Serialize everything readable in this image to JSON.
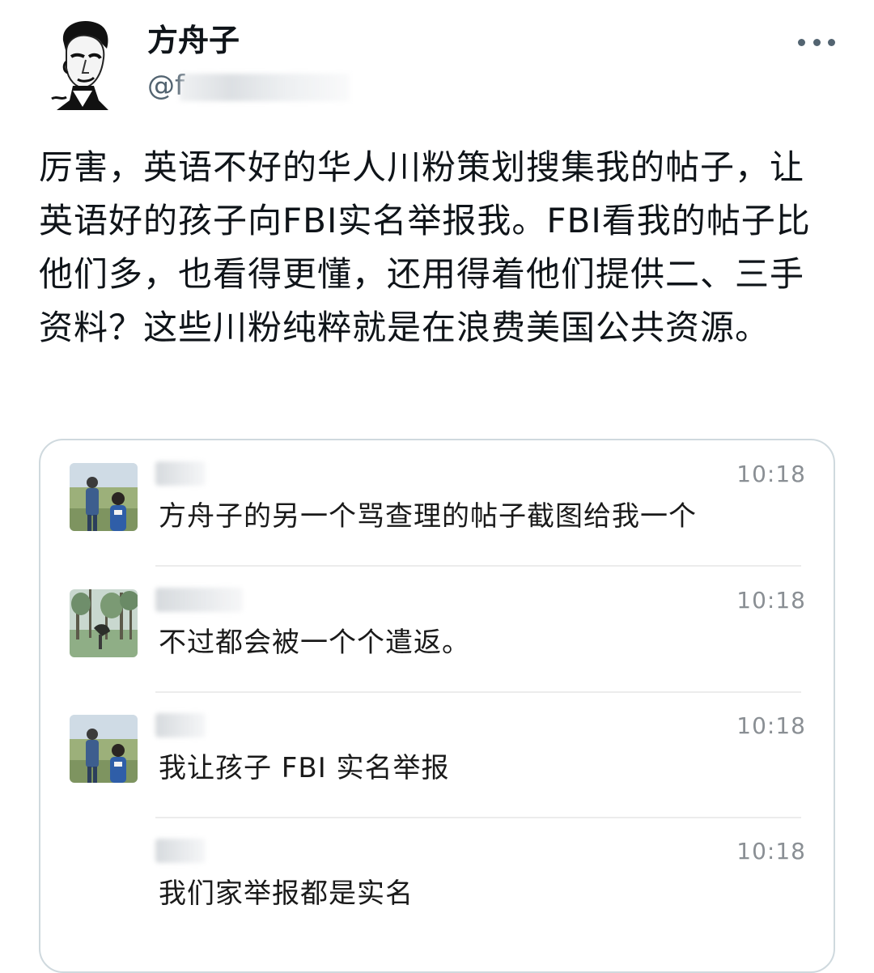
{
  "post": {
    "author_name": "方舟子",
    "handle_visible": "@f",
    "text": "厉害，英语不好的华人川粉策划搜集我的帖子，让英语好的孩子向FBI实名举报我。FBI看我的帖子比他们多，也看得更懂，还用得着他们提供二、三手资料？这些川粉纯粹就是在浪费美国公共资源。",
    "more_icon": "more-horizontal-icon"
  },
  "embedded_chat": {
    "messages": [
      {
        "time": "10:18",
        "text": "方舟子的另一个骂查理的帖子截图给我一个",
        "avatar": "photo-two-people"
      },
      {
        "time": "10:18",
        "text": "不过都会被一个个遣返。",
        "avatar": "photo-park-trees"
      },
      {
        "time": "10:18",
        "text": "我让孩子 FBI 实名举报",
        "avatar": "photo-two-people"
      },
      {
        "time": "10:18",
        "text": "我们家举报都是实名",
        "avatar": ""
      }
    ]
  },
  "colors": {
    "text_primary": "#0f1419",
    "text_secondary": "#536471",
    "card_border": "#cfd9de",
    "chat_time": "#8a8f94"
  }
}
